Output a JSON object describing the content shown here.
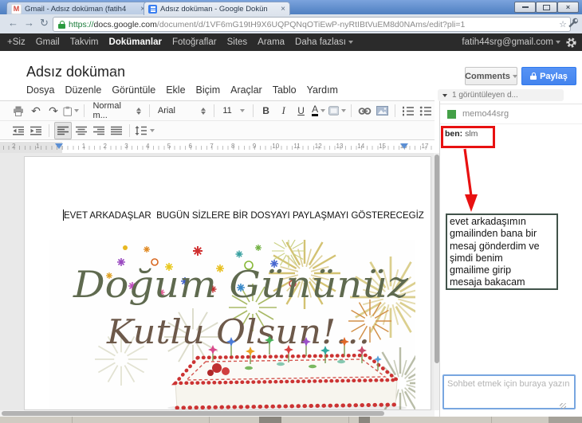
{
  "browser": {
    "tabs": [
      {
        "title": "Gmail - Adsız doküman (fatih4"
      },
      {
        "title": "Adsız doküman - Google Dokün"
      }
    ],
    "close_glyph": "×",
    "icons": {
      "back": "←",
      "forward": "→",
      "reload": "↻",
      "bookmark": "☆"
    },
    "address": {
      "scheme": "https://",
      "host": "docs.google.com",
      "path": "/document/d/1VF6mG19tH9X6UQPQNqOTiEwP-nyRtIBtVuEM8d0NAms/edit?pli=1"
    }
  },
  "google_bar": {
    "items": [
      "+Siz",
      "Gmail",
      "Takvim",
      "Dokümanlar",
      "Fotoğraflar",
      "Sites",
      "Arama",
      "Daha fazlası"
    ],
    "account": "fatih44srg@gmail.com"
  },
  "header": {
    "doc_title": "Adsız doküman",
    "title_star": "☆",
    "menus": [
      "Dosya",
      "Düzenle",
      "Görüntüle",
      "Ekle",
      "Biçim",
      "Araçlar",
      "Tablo",
      "Yardım"
    ],
    "comments_label": "Comments",
    "share_label": "Paylaş"
  },
  "toolbar": {
    "undo_glyph": "↶",
    "redo_glyph": "↷",
    "paragraph_style": "Normal m...",
    "font_name": "Arial",
    "font_size": "11",
    "bold": "B",
    "italic": "I",
    "underline": "U",
    "text_color": "A"
  },
  "ruler": {
    "margin_numbers": [
      "2",
      "1"
    ],
    "numbers": [
      "1",
      "2",
      "3",
      "4",
      "5",
      "6",
      "7",
      "8",
      "9",
      "10",
      "11",
      "12",
      "13",
      "14",
      "15",
      "16",
      "17"
    ]
  },
  "editor": {
    "text_line": "EVET ARKADAŞLAR  BUGÜN SİZLERE BİR DOSYAYI PAYLAŞMAYI GÖSTERECEGİZ",
    "image_text_line1": "Doğum Gününüz",
    "image_text_line2": "Kutlu Olsun!..."
  },
  "sidebar": {
    "viewers_summary": "1 görüntüleyen d...",
    "viewer_name": "memo44srg",
    "chat_author": "ben:",
    "chat_message": " slm",
    "note_text": "evet arkadaşımın\ngmailinden bana bir\nmesaj gönderdim ve\nşimdi benim\ngmailime girip\nmesaja bakacam",
    "chat_placeholder": "Sohbet etmek için buraya yazın"
  },
  "colors": {
    "share_button": "#4d90fe",
    "presence_green": "#43a047",
    "annotation_red": "#e81111",
    "chrome_frame": "#5a87c6"
  }
}
